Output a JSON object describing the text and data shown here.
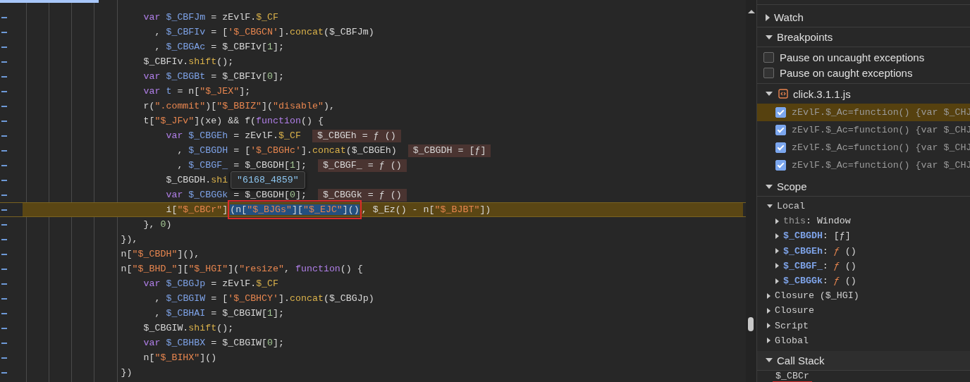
{
  "editor": {
    "lines": [
      {
        "paused": false,
        "tokens": [
          {
            "kind": "k",
            "text": "                        var"
          },
          {
            "kind": "v",
            "text": " $_CBFJm"
          },
          {
            "kind": "p",
            "text": " = zEvlF."
          },
          {
            "kind": "m",
            "text": "$_CF"
          }
        ]
      },
      {
        "paused": false,
        "tokens": [
          {
            "kind": "p",
            "text": "                          , "
          },
          {
            "kind": "v",
            "text": "$_CBFIv"
          },
          {
            "kind": "p",
            "text": " = ["
          },
          {
            "kind": "s",
            "text": "'$_CBGCN'"
          },
          {
            "kind": "p",
            "text": "]."
          },
          {
            "kind": "m",
            "text": "concat"
          },
          {
            "kind": "p",
            "text": "($_CBFJm)"
          }
        ]
      },
      {
        "paused": false,
        "tokens": [
          {
            "kind": "p",
            "text": "                          , "
          },
          {
            "kind": "v",
            "text": "$_CBGAc"
          },
          {
            "kind": "p",
            "text": " = $_CBFIv["
          },
          {
            "kind": "n",
            "text": "1"
          },
          {
            "kind": "p",
            "text": "];"
          }
        ]
      },
      {
        "paused": false,
        "tokens": [
          {
            "kind": "p",
            "text": "                        $_CBFIv."
          },
          {
            "kind": "m",
            "text": "shift"
          },
          {
            "kind": "p",
            "text": "();"
          }
        ]
      },
      {
        "paused": false,
        "tokens": [
          {
            "kind": "k",
            "text": "                        var"
          },
          {
            "kind": "v",
            "text": " $_CBGBt"
          },
          {
            "kind": "p",
            "text": " = $_CBFIv["
          },
          {
            "kind": "n",
            "text": "0"
          },
          {
            "kind": "p",
            "text": "];"
          }
        ]
      },
      {
        "paused": false,
        "tokens": [
          {
            "kind": "k",
            "text": "                        var"
          },
          {
            "kind": "v",
            "text": " t"
          },
          {
            "kind": "p",
            "text": " = n["
          },
          {
            "kind": "s",
            "text": "\"$_JEX\""
          },
          {
            "kind": "p",
            "text": "];"
          }
        ]
      },
      {
        "paused": false,
        "tokens": [
          {
            "kind": "p",
            "text": "                        r("
          },
          {
            "kind": "s",
            "text": "\".commit\""
          },
          {
            "kind": "p",
            "text": ")["
          },
          {
            "kind": "s",
            "text": "\"$_BBIZ\""
          },
          {
            "kind": "p",
            "text": "]("
          },
          {
            "kind": "s",
            "text": "\"disable\""
          },
          {
            "kind": "p",
            "text": "),"
          }
        ]
      },
      {
        "paused": false,
        "tokens": [
          {
            "kind": "p",
            "text": "                        t["
          },
          {
            "kind": "s",
            "text": "\"$_JFv\""
          },
          {
            "kind": "p",
            "text": "](xe) && f("
          },
          {
            "kind": "k",
            "text": "function"
          },
          {
            "kind": "p",
            "text": "() {"
          }
        ]
      },
      {
        "paused": false,
        "tokens": [
          {
            "kind": "k",
            "text": "                            var"
          },
          {
            "kind": "v",
            "text": " $_CBGEh"
          },
          {
            "kind": "p",
            "text": " = zEvlF."
          },
          {
            "kind": "m",
            "text": "$_CF"
          }
        ],
        "hint": "$_CBGEh = ƒ ()"
      },
      {
        "paused": false,
        "tokens": [
          {
            "kind": "p",
            "text": "                              , "
          },
          {
            "kind": "v",
            "text": "$_CBGDH"
          },
          {
            "kind": "p",
            "text": " = ["
          },
          {
            "kind": "s",
            "text": "'$_CBGHc'"
          },
          {
            "kind": "p",
            "text": "]."
          },
          {
            "kind": "m",
            "text": "concat"
          },
          {
            "kind": "p",
            "text": "($_CBGEh)"
          }
        ],
        "hint": "$_CBGDH = [ƒ]"
      },
      {
        "paused": false,
        "tokens": [
          {
            "kind": "p",
            "text": "                              , "
          },
          {
            "kind": "v",
            "text": "$_CBGF_"
          },
          {
            "kind": "p",
            "text": " = $_CBGDH["
          },
          {
            "kind": "n",
            "text": "1"
          },
          {
            "kind": "p",
            "text": "];"
          }
        ],
        "hint": "$_CBGF_ = ƒ ()"
      },
      {
        "paused": false,
        "tokens": [
          {
            "kind": "p",
            "text": "                            $_CBGDH."
          },
          {
            "kind": "m",
            "text": "shi"
          }
        ]
      },
      {
        "paused": false,
        "tokens": [
          {
            "kind": "k",
            "text": "                            var"
          },
          {
            "kind": "v",
            "text": " $_CBGGk"
          },
          {
            "kind": "p",
            "text": " = $_CBGDH["
          },
          {
            "kind": "n",
            "text": "0"
          },
          {
            "kind": "p",
            "text": "];"
          }
        ],
        "hint": "$_CBGGk = ƒ ()"
      },
      {
        "paused": true,
        "tokens": [
          {
            "kind": "p",
            "text": "                            i["
          },
          {
            "kind": "s",
            "text": "\"$_CBCr\""
          },
          {
            "kind": "p",
            "text": "]"
          }
        ],
        "selection": {
          "annotated": true,
          "tokens": [
            {
              "kind": "p",
              "text": "(n["
            },
            {
              "kind": "s",
              "text": "\"$_BJGs\""
            },
            {
              "kind": "p",
              "text": "]["
            },
            {
              "kind": "s",
              "text": "\"$_EJC\""
            },
            {
              "kind": "p",
              "text": "]()"
            }
          ]
        },
        "after": [
          {
            "kind": "p",
            "text": ", $_Ez() - n["
          },
          {
            "kind": "s",
            "text": "\"$_BJBT\""
          },
          {
            "kind": "p",
            "text": "])"
          }
        ]
      },
      {
        "paused": false,
        "tokens": [
          {
            "kind": "p",
            "text": "                        }, "
          },
          {
            "kind": "n",
            "text": "0"
          },
          {
            "kind": "p",
            "text": ")"
          }
        ]
      },
      {
        "paused": false,
        "tokens": [
          {
            "kind": "p",
            "text": "                    }),"
          }
        ]
      },
      {
        "paused": false,
        "tokens": [
          {
            "kind": "p",
            "text": "                    n["
          },
          {
            "kind": "s",
            "text": "\"$_CBDH\""
          },
          {
            "kind": "p",
            "text": "](),"
          }
        ]
      },
      {
        "paused": false,
        "tokens": [
          {
            "kind": "p",
            "text": "                    n["
          },
          {
            "kind": "s",
            "text": "\"$_BHD_\""
          },
          {
            "kind": "p",
            "text": "]["
          },
          {
            "kind": "s",
            "text": "\"$_HGI\""
          },
          {
            "kind": "p",
            "text": "]("
          },
          {
            "kind": "s",
            "text": "\"resize\""
          },
          {
            "kind": "p",
            "text": ", "
          },
          {
            "kind": "k",
            "text": "function"
          },
          {
            "kind": "p",
            "text": "() {"
          }
        ]
      },
      {
        "paused": false,
        "tokens": [
          {
            "kind": "k",
            "text": "                        var"
          },
          {
            "kind": "v",
            "text": " $_CBGJp"
          },
          {
            "kind": "p",
            "text": " = zEvlF."
          },
          {
            "kind": "m",
            "text": "$_CF"
          }
        ]
      },
      {
        "paused": false,
        "tokens": [
          {
            "kind": "p",
            "text": "                          , "
          },
          {
            "kind": "v",
            "text": "$_CBGIW"
          },
          {
            "kind": "p",
            "text": " = ["
          },
          {
            "kind": "s",
            "text": "'$_CBHCY'"
          },
          {
            "kind": "p",
            "text": "]."
          },
          {
            "kind": "m",
            "text": "concat"
          },
          {
            "kind": "p",
            "text": "($_CBGJp)"
          }
        ]
      },
      {
        "paused": false,
        "tokens": [
          {
            "kind": "p",
            "text": "                          , "
          },
          {
            "kind": "v",
            "text": "$_CBHAI"
          },
          {
            "kind": "p",
            "text": " = $_CBGIW["
          },
          {
            "kind": "n",
            "text": "1"
          },
          {
            "kind": "p",
            "text": "];"
          }
        ]
      },
      {
        "paused": false,
        "tokens": [
          {
            "kind": "p",
            "text": "                        $_CBGIW."
          },
          {
            "kind": "m",
            "text": "shift"
          },
          {
            "kind": "p",
            "text": "();"
          }
        ]
      },
      {
        "paused": false,
        "tokens": [
          {
            "kind": "k",
            "text": "                        var"
          },
          {
            "kind": "v",
            "text": " $_CBHBX"
          },
          {
            "kind": "p",
            "text": " = $_CBGIW["
          },
          {
            "kind": "n",
            "text": "0"
          },
          {
            "kind": "p",
            "text": "];"
          }
        ]
      },
      {
        "paused": false,
        "tokens": [
          {
            "kind": "p",
            "text": "                        n["
          },
          {
            "kind": "s",
            "text": "\"$_BIHX\""
          },
          {
            "kind": "p",
            "text": "]()"
          }
        ]
      },
      {
        "paused": false,
        "tokens": [
          {
            "kind": "p",
            "text": "                    })"
          }
        ]
      }
    ],
    "tooltip": "\"6168_4859\""
  },
  "panel": {
    "sections": [
      {
        "kind": "watch",
        "title": "Watch",
        "expanded": false
      },
      {
        "kind": "breakpoints",
        "title": "Breakpoints",
        "expanded": true,
        "options": [
          {
            "label": "Pause on uncaught exceptions",
            "checked": false
          },
          {
            "label": "Pause on caught exceptions",
            "checked": false
          }
        ],
        "files": [
          {
            "name": "click.3.1.1.js",
            "expanded": true,
            "breakpoints": [
              {
                "code": "zEvlF.$_Ac=function() {var $_CHJ",
                "checked": true,
                "selected": true
              },
              {
                "code": "zEvlF.$_Ac=function() {var $_CHJ",
                "checked": true,
                "selected": false
              },
              {
                "code": "zEvlF.$_Ac=function() {var $_CHJ",
                "checked": true,
                "selected": false
              },
              {
                "code": "zEvlF.$_Ac=function() {var $_CHJ",
                "checked": true,
                "selected": false
              }
            ]
          }
        ]
      },
      {
        "kind": "scope",
        "title": "Scope",
        "expanded": true,
        "scopes": [
          {
            "label": "Local",
            "expanded": true,
            "children": [
              {
                "kind": "receiver",
                "name": "this",
                "value": [
                  {
                    "kind": "p",
                    "text": ": Window"
                  }
                ],
                "expanded": false
              },
              {
                "kind": "variable",
                "name": "$_CBGDH",
                "value": [
                  {
                    "kind": "p",
                    "text": ": [ƒ]"
                  }
                ],
                "expanded": false
              },
              {
                "kind": "variable",
                "name": "$_CBGEh",
                "value": [
                  {
                    "kind": "p",
                    "text": ": "
                  },
                  {
                    "kind": "f",
                    "text": "ƒ"
                  },
                  {
                    "kind": "p",
                    "text": " ()"
                  }
                ],
                "expanded": false
              },
              {
                "kind": "variable",
                "name": "$_CBGF_",
                "value": [
                  {
                    "kind": "p",
                    "text": ": "
                  },
                  {
                    "kind": "f",
                    "text": "ƒ"
                  },
                  {
                    "kind": "p",
                    "text": " ()"
                  }
                ],
                "expanded": false
              },
              {
                "kind": "variable",
                "name": "$_CBGGk",
                "value": [
                  {
                    "kind": "p",
                    "text": ": "
                  },
                  {
                    "kind": "f",
                    "text": "ƒ"
                  },
                  {
                    "kind": "p",
                    "text": " ()"
                  }
                ],
                "expanded": false
              }
            ]
          },
          {
            "label": "Closure ($_HGI)",
            "expanded": false
          },
          {
            "label": "Closure",
            "expanded": false
          },
          {
            "label": "Script",
            "expanded": false
          },
          {
            "label": "Global",
            "expanded": false
          }
        ]
      },
      {
        "kind": "callstack",
        "title": "Call Stack",
        "expanded": true,
        "frames": [
          {
            "name": "$_CBCr",
            "annotated": true
          }
        ]
      }
    ]
  }
}
